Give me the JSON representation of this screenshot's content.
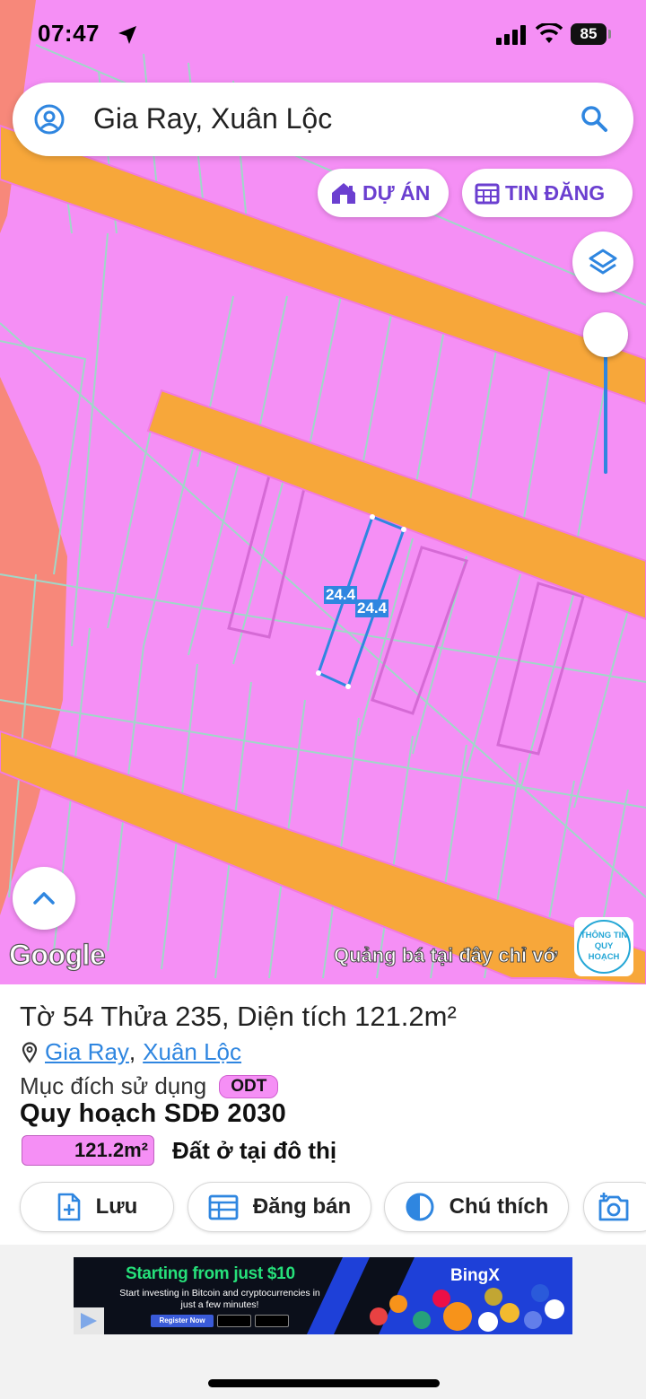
{
  "status_bar": {
    "time": "07:47",
    "battery": "85"
  },
  "search": {
    "query": "Gia Ray, Xuân Lộc"
  },
  "chips": {
    "projects": "DỰ ÁN",
    "listings": "TIN ĐĂNG"
  },
  "map": {
    "attribution": "Google",
    "ad_text": "Quảng bá tại đây chỉ vớ",
    "plan_info_line1": "THÔNG TIN",
    "plan_info_line2": "QUY HOẠCH",
    "dim_left": "24.4",
    "dim_right": "24.4",
    "colors": {
      "residential": "#f58ff5",
      "road": "#f7a73a",
      "boundary": "#9fd8c8",
      "selection": "#2f86e0"
    }
  },
  "parcel": {
    "title": "Tờ 54 Thửa 235, Diện tích 121.2m²",
    "ward": "Gia Ray",
    "separator": ",",
    "district": "Xuân Lộc",
    "purpose_label": "Mục đích sử dụng",
    "purpose_code": "ODT",
    "plan_title": "Quy hoạch SDĐ 2030",
    "zone_area": "121.2m²",
    "zone_name": "Đất ở tại đô thị"
  },
  "actions": {
    "save": "Lưu",
    "sell": "Đăng bán",
    "legend": "Chú thích"
  },
  "ad": {
    "headline": "Starting from just $10",
    "sub": "Start investing in Bitcoin and cryptocurrencies in just a few minutes!",
    "cta": "Register Now",
    "brand": "BingX"
  }
}
